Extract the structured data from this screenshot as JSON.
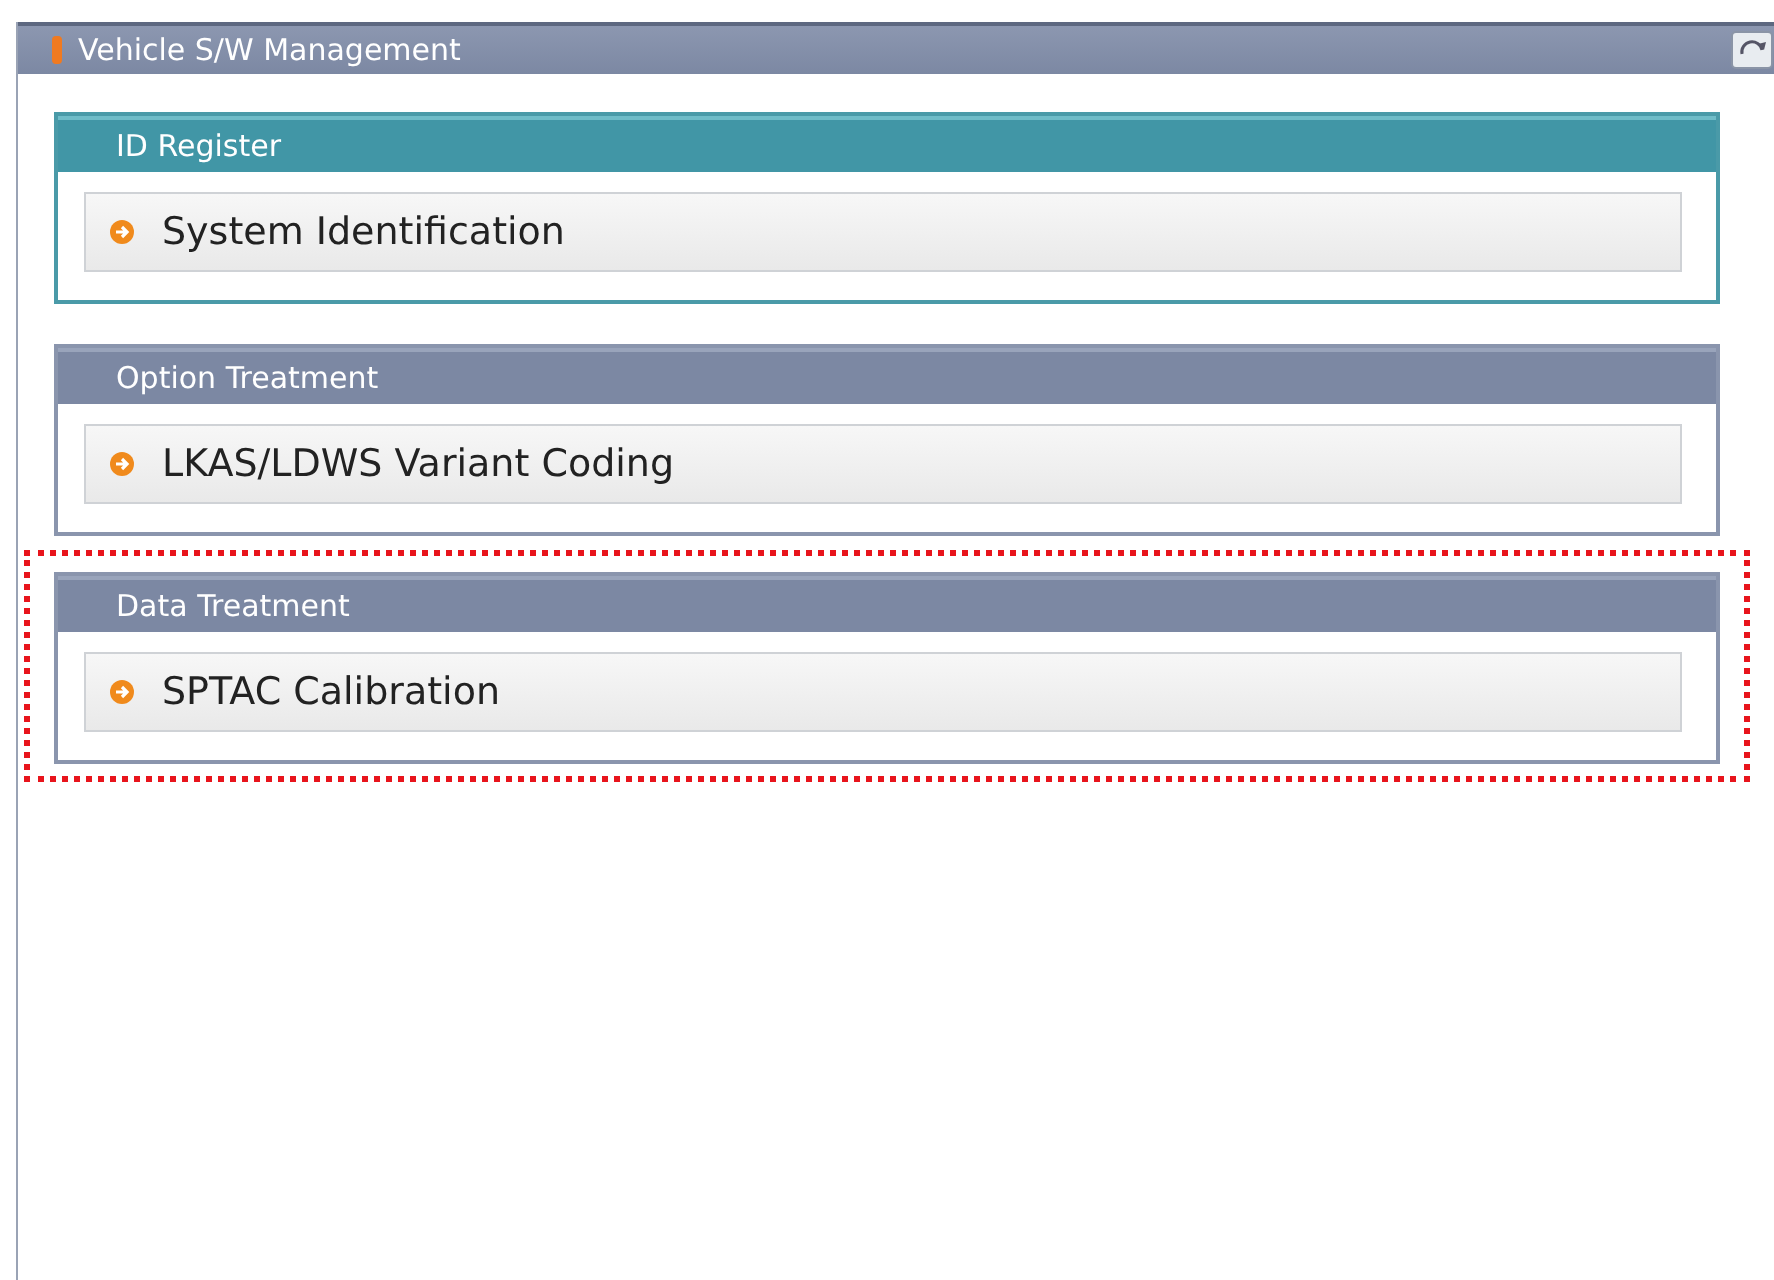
{
  "window": {
    "title": "Vehicle S/W Management"
  },
  "groups": [
    {
      "title": "ID Register",
      "selected": true,
      "highlighted": false,
      "items": [
        "System Identification"
      ]
    },
    {
      "title": "Option Treatment",
      "selected": false,
      "highlighted": false,
      "items": [
        "LKAS/LDWS Variant Coding"
      ]
    },
    {
      "title": "Data Treatment",
      "selected": false,
      "highlighted": true,
      "items": [
        "SPTAC Calibration"
      ]
    }
  ]
}
